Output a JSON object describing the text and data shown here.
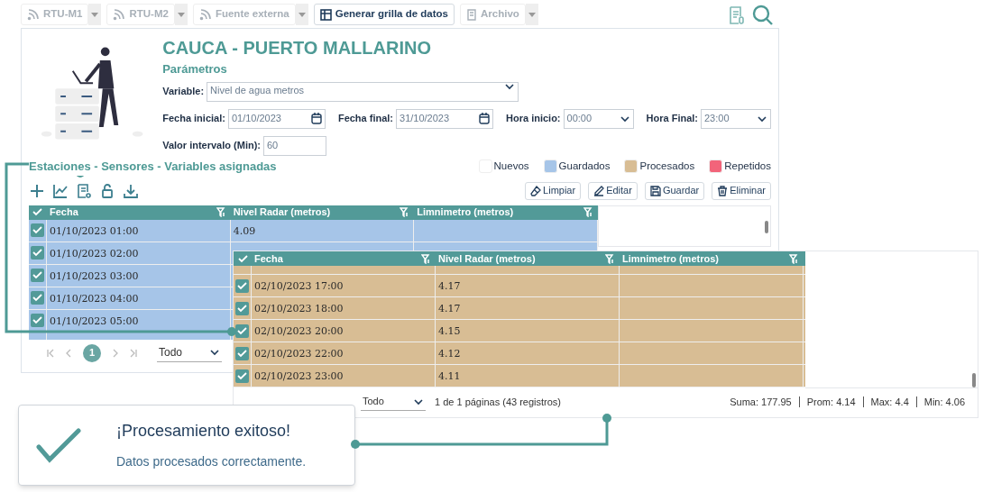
{
  "toolbar": [
    {
      "label": "RTU-M1",
      "kind": "split",
      "disabled": true
    },
    {
      "label": "RTU-M2",
      "kind": "split",
      "disabled": true
    },
    {
      "label": "Fuente externa",
      "kind": "split",
      "disabled": true
    },
    {
      "label": "Generar grilla de datos",
      "kind": "button",
      "disabled": false
    },
    {
      "label": "Archivo",
      "kind": "split",
      "disabled": true
    }
  ],
  "station": {
    "title": "CAUCA - PUERTO MALLARINO",
    "section": "Parámetros"
  },
  "form": {
    "variable": {
      "label": "Variable:",
      "value": "Nivel de agua metros"
    },
    "fecha_inicial": {
      "label": "Fecha inicial:",
      "value": "01/10/2023"
    },
    "fecha_final": {
      "label": "Fecha final:",
      "value": "31/10/2023"
    },
    "hora_inicio": {
      "label": "Hora inicio:",
      "value": "00:00"
    },
    "hora_final": {
      "label": "Hora Final:",
      "value": "23:00"
    },
    "intervalo": {
      "label": "Valor intervalo (Min):",
      "value": "60"
    }
  },
  "assigned_title": "Estaciones - Sensores - Variables asignadas",
  "legend": [
    {
      "label": "Nuevos",
      "color": "#ffffff"
    },
    {
      "label": "Guardados",
      "color": "#a6c5e8"
    },
    {
      "label": "Procesados",
      "color": "#d8bd94"
    },
    {
      "label": "Repetidos",
      "color": "#f2647a"
    }
  ],
  "actions": [
    {
      "label": "Limpiar",
      "kind": "eraser"
    },
    {
      "label": "Editar",
      "kind": "pencil"
    },
    {
      "label": "Guardar",
      "kind": "save"
    },
    {
      "label": "Eliminar",
      "kind": "trash"
    }
  ],
  "grid": {
    "columns": [
      "Fecha",
      "Nivel Radar (metros)",
      "Limnimetro (metros)"
    ],
    "rows": [
      {
        "checked": true,
        "color": "#a6c5e8",
        "cells": [
          "01/10/2023 01:00",
          "4.09"
        ]
      },
      {
        "checked": true,
        "color": "#a6c5e8",
        "cells": [
          "01/10/2023 02:00"
        ]
      },
      {
        "checked": true,
        "color": "#a6c5e8",
        "cells": [
          "01/10/2023 03:00"
        ]
      },
      {
        "checked": true,
        "color": "#a6c5e8",
        "cells": [
          "01/10/2023 04:00"
        ]
      },
      {
        "checked": true,
        "color": "#a6c5e8",
        "cells": [
          "01/10/2023 05:00"
        ]
      }
    ],
    "pagination": {
      "page": "1",
      "page_size": "Todo"
    }
  },
  "zoom_grid": {
    "columns": [
      "Fecha",
      "Nivel Radar (metros)",
      "Limnimetro (metros)"
    ],
    "rows": [
      {
        "checked": true,
        "color": "#d8bd94",
        "cells": [
          "02/10/2023 17:00",
          "4.17"
        ]
      },
      {
        "checked": true,
        "color": "#d8bd94",
        "cells": [
          "02/10/2023 18:00",
          "4.17"
        ]
      },
      {
        "checked": true,
        "color": "#d8bd94",
        "cells": [
          "02/10/2023 20:00",
          "4.15"
        ]
      },
      {
        "checked": true,
        "color": "#d8bd94",
        "cells": [
          "02/10/2023 22:00",
          "4.12"
        ]
      },
      {
        "checked": true,
        "color": "#d8bd94",
        "cells": [
          "02/10/2023 23:00",
          "4.11"
        ]
      }
    ],
    "pagination": {
      "page_size": "Todo",
      "summary": "1 de 1 páginas (43 registros)"
    },
    "stats": [
      "Suma: 177.95",
      "Prom: 4.14",
      "Max: 4.4",
      "Min: 4.06"
    ]
  },
  "toast": {
    "title": "¡Procesamiento exitoso!",
    "message": "Datos procesados correctamente."
  }
}
